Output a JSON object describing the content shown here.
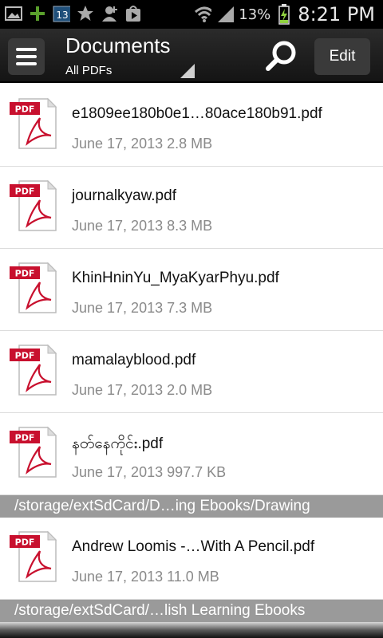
{
  "status_bar": {
    "battery": "13%",
    "time": "8:21 PM",
    "calendar_day": "13",
    "icons": [
      "picture-icon",
      "plus-icon",
      "calendar-icon",
      "star-icon",
      "add-contact-icon",
      "play-store-icon",
      "wifi-icon",
      "signal-icon",
      "battery-charging-icon"
    ]
  },
  "toolbar": {
    "title": "Documents",
    "subtitle": "All PDFs",
    "edit_label": "Edit"
  },
  "list": {
    "items": [
      {
        "name": "e1809ee180b0e1…80ace180b91.pdf",
        "date": "June 17, 2013",
        "size": "2.8 MB"
      },
      {
        "name": "journalkyaw.pdf",
        "date": "June 17, 2013",
        "size": "8.3 MB"
      },
      {
        "name": "KhinHninYu_MyaKyarPhyu.pdf",
        "date": "June 17, 2013",
        "size": "7.3 MB"
      },
      {
        "name": "mamalayblood.pdf",
        "date": "June 17, 2013",
        "size": "2.0 MB"
      },
      {
        "name": "နတ်နေကိုင်း.pdf",
        "date": "June 17, 2013",
        "size": "997.7 KB"
      }
    ],
    "section1": "/storage/extSdCard/D…ing Ebooks/Drawing",
    "section1_items": [
      {
        "name": "Andrew Loomis -…With A Pencil.pdf",
        "date": "June 17, 2013",
        "size": "11.0 MB"
      }
    ],
    "section2": "/storage/extSdCard/…lish Learning Ebooks"
  },
  "colors": {
    "toolbar_bg": "#1e1e1e",
    "section_header_bg": "#9a9a9a",
    "pdf_red": "#c8102e",
    "meta_gray": "#8a8a8a"
  }
}
